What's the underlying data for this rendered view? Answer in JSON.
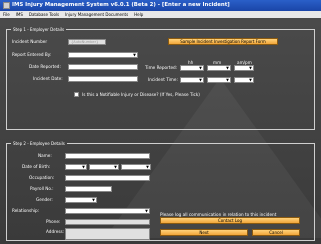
{
  "title": "IMS Injury Management System v6.0.1 (Beta 2) - [Enter a new Incident]",
  "menu": [
    "File",
    "IMS",
    "Database Tools",
    "Injury Management Documents",
    "Help"
  ],
  "step1": {
    "legend": "Step 1 - Employer Details",
    "incident_number_label": "Incident Number",
    "incident_number_value": "{AutoNumber}",
    "report_entered_by_label": "Report Entered By:",
    "date_reported_label": "Date Reported:",
    "incident_date_label": "Incident Date:",
    "sample_button": "Sample Incident Investigation Report Form",
    "col_hh": "hh",
    "col_mm": "mm",
    "col_ampm": "am/pm",
    "time_reported_label": "Time Reported:",
    "incident_time_label": "Incident Time:",
    "notifiable_label": "Is this a Notifiable Injury or Disease? (If Yes, Please Tick)"
  },
  "step2": {
    "legend": "Step 2 - Employee Details",
    "name_label": "Name:",
    "dob_label": "Date of Birth:",
    "occupation_label": "Occupation:",
    "payroll_label": "Payroll No.:",
    "gender_label": "Gender:",
    "relationship_label": "Relationship:",
    "phone_label": "Phone:",
    "address_label": "Address:",
    "log_note": "Please log all communication in relation to this incident",
    "contact_log_button": "Contact Log",
    "next_button": "Next",
    "cancel_button": "Cancel"
  }
}
